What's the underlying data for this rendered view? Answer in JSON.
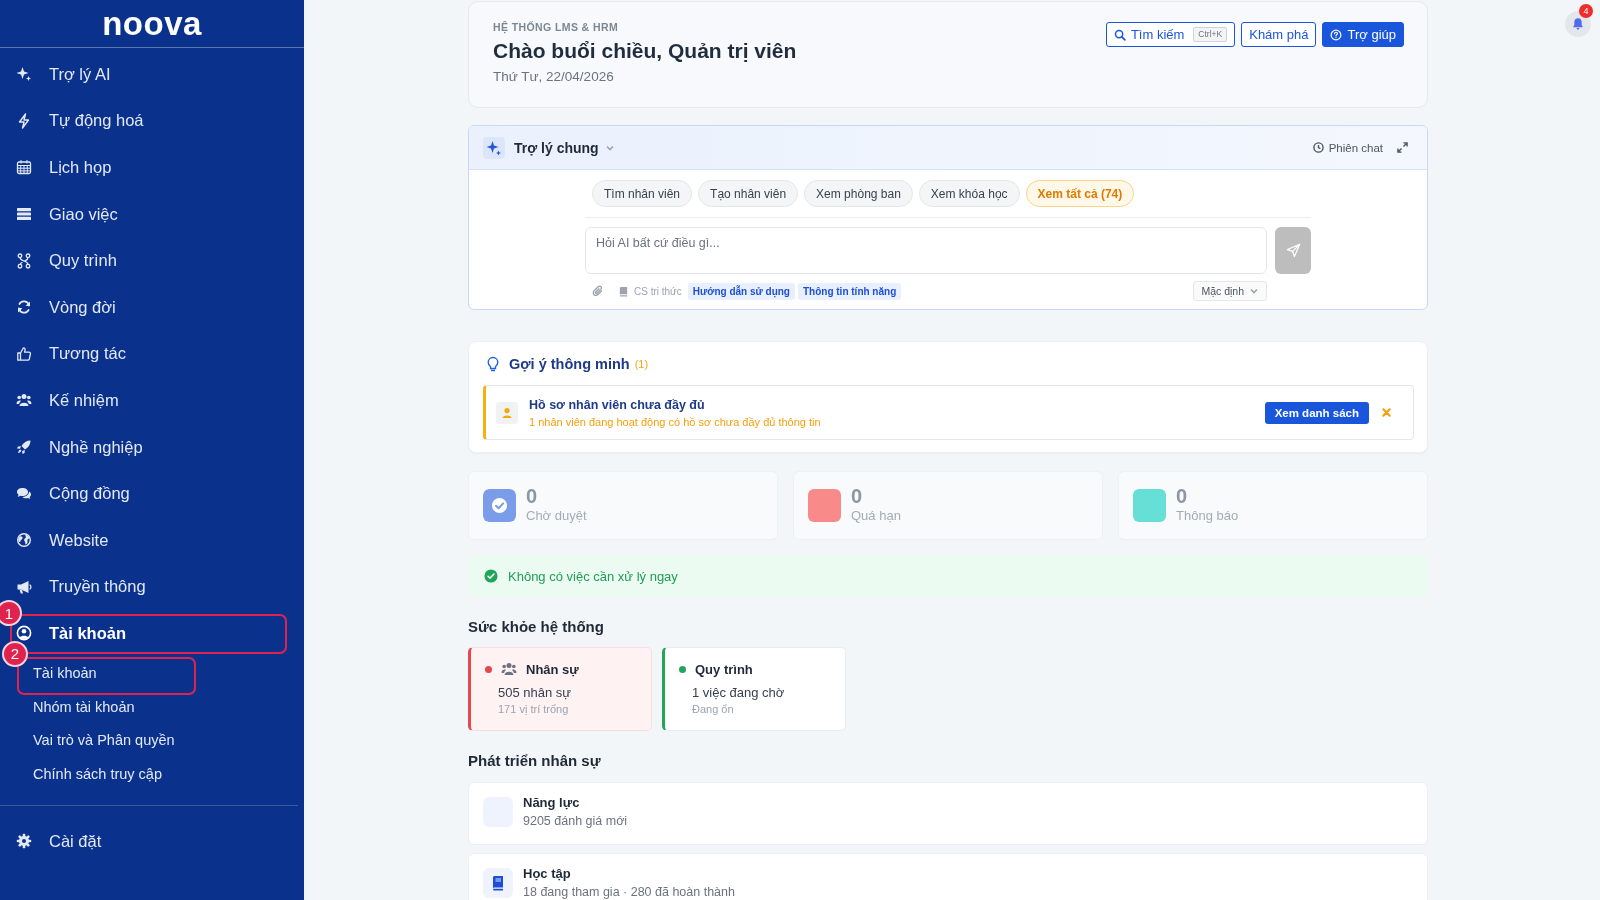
{
  "sidebar": {
    "logo": "noova",
    "items": [
      {
        "label": "Trợ lý AI",
        "selected": false
      },
      {
        "label": "Tự động hoá",
        "selected": false
      },
      {
        "label": "Lịch họp",
        "selected": false
      },
      {
        "label": "Giao việc",
        "selected": false
      },
      {
        "label": "Quy trình",
        "selected": false
      },
      {
        "label": "Vòng đời",
        "selected": false
      },
      {
        "label": "Tương tác",
        "selected": false
      },
      {
        "label": "Kế nhiệm",
        "selected": false
      },
      {
        "label": "Nghề nghiệp",
        "selected": false
      },
      {
        "label": "Cộng đồng",
        "selected": false
      },
      {
        "label": "Website",
        "selected": false
      },
      {
        "label": "Truyền thông",
        "selected": false
      },
      {
        "label": "Tài khoản",
        "selected": true,
        "expanded": true,
        "callout": "1",
        "children": [
          {
            "label": "Tài khoản",
            "selected": false,
            "callout": "2"
          },
          {
            "label": "Nhóm tài khoản",
            "selected": false
          },
          {
            "label": "Vai trò và Phân quyền",
            "selected": false
          },
          {
            "label": "Chính sách truy cập",
            "selected": false
          }
        ]
      }
    ],
    "footer_items": [
      {
        "label": "Cài đặt",
        "selected": false
      }
    ]
  },
  "notifications": {
    "count": "4"
  },
  "header": {
    "eyebrow": "HỆ THỐNG LMS & HRM",
    "title": "Chào buổi chiều, Quản trị viên",
    "date": "Thứ Tư, 22/04/2026",
    "actions": [
      {
        "kind": "search",
        "label": "Tìm kiếm",
        "shortcut": "Ctrl+K"
      },
      {
        "kind": "outline",
        "label": "Khám phá"
      },
      {
        "kind": "primary",
        "label": "Trợ giúp"
      }
    ]
  },
  "assistant": {
    "name": "Trợ lý chung",
    "session_label": "Phiên chat",
    "quick_actions": [
      {
        "kind": "action",
        "label": "Tìm nhân viên"
      },
      {
        "kind": "action",
        "label": "Tạo nhân viên"
      },
      {
        "kind": "action",
        "label": "Xem phòng ban"
      },
      {
        "kind": "action",
        "label": "Xem khóa học"
      },
      {
        "kind": "more",
        "label": "Xem tất cả (74)"
      }
    ],
    "input": {
      "placeholder": "Hỏi AI bất cứ điều gì..."
    },
    "send": {
      "disabled": true
    },
    "knowledge_label": "CS tri thức",
    "tags": [
      "Hướng dẫn sử dụng",
      "Thông tin tính năng"
    ],
    "mode": "Mặc định"
  },
  "suggestions": {
    "title": "Gợi ý thông minh",
    "count": "(1)",
    "items": [
      {
        "title": "Hồ sơ nhân viên chưa đầy đủ",
        "description": "1 nhân viên đang hoạt động có hồ sơ chưa đầy đủ thông tin",
        "action": "Xem danh sách"
      }
    ]
  },
  "stats": [
    {
      "kind": "check",
      "value": "0",
      "label": "Chờ duyệt",
      "color": "#7b9de9"
    },
    {
      "kind": "plain",
      "value": "0",
      "label": "Quá hạn",
      "color": "#f98a8a"
    },
    {
      "kind": "plain",
      "value": "0",
      "label": "Thông báo",
      "color": "#66e0d6"
    }
  ],
  "status_banner": {
    "text": "Không có việc cần xử lý ngay"
  },
  "health": {
    "title": "Sức khỏe hệ thống",
    "items": [
      {
        "kind": "people",
        "title": "Nhân sự",
        "value": "505 nhân sự",
        "detail": "171 vị trí trống",
        "color": "#e5484d",
        "highlighted": true
      },
      {
        "kind": "plain",
        "title": "Quy trình",
        "value": "1 việc đang chờ",
        "detail": "Đang ổn",
        "color": "#22a55b",
        "highlighted": false
      }
    ]
  },
  "development": {
    "title": "Phát triển nhân sự",
    "items": [
      {
        "kind": "blank",
        "title": "Năng lực",
        "detail": "9205 đánh giá mới"
      },
      {
        "kind": "book",
        "title": "Học tập",
        "detail": "18 đang tham gia · 280 đã hoàn thành"
      }
    ]
  }
}
